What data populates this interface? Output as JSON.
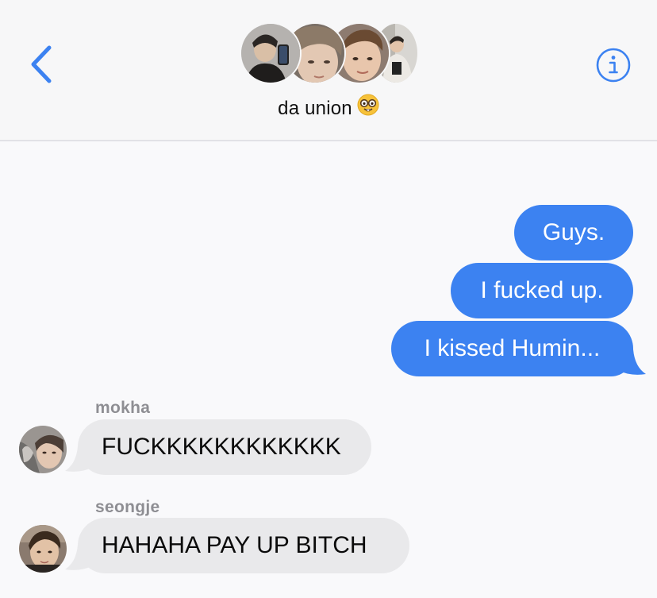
{
  "header": {
    "group_name": "da union",
    "group_emoji": "nerd-face-emoji",
    "back_icon": "chevron-left-icon",
    "info_icon": "info-circle-icon",
    "accent_color": "#3c82f1",
    "participant_count_shown": 4
  },
  "messages": [
    {
      "direction": "outgoing",
      "text": "Guys."
    },
    {
      "direction": "outgoing",
      "text": "I fucked up."
    },
    {
      "direction": "outgoing",
      "text": "I kissed Humin..."
    },
    {
      "direction": "incoming",
      "sender": "mokha",
      "text": "FUCKKKKKKKKKKKK"
    },
    {
      "direction": "incoming",
      "sender": "seongje",
      "text": "HAHAHA PAY UP BITCH"
    }
  ],
  "colors": {
    "outgoing_bubble": "#3c82f1",
    "incoming_bubble": "#e9e9eb",
    "sender_label": "#8e8e93",
    "background": "#f9f9fb"
  }
}
